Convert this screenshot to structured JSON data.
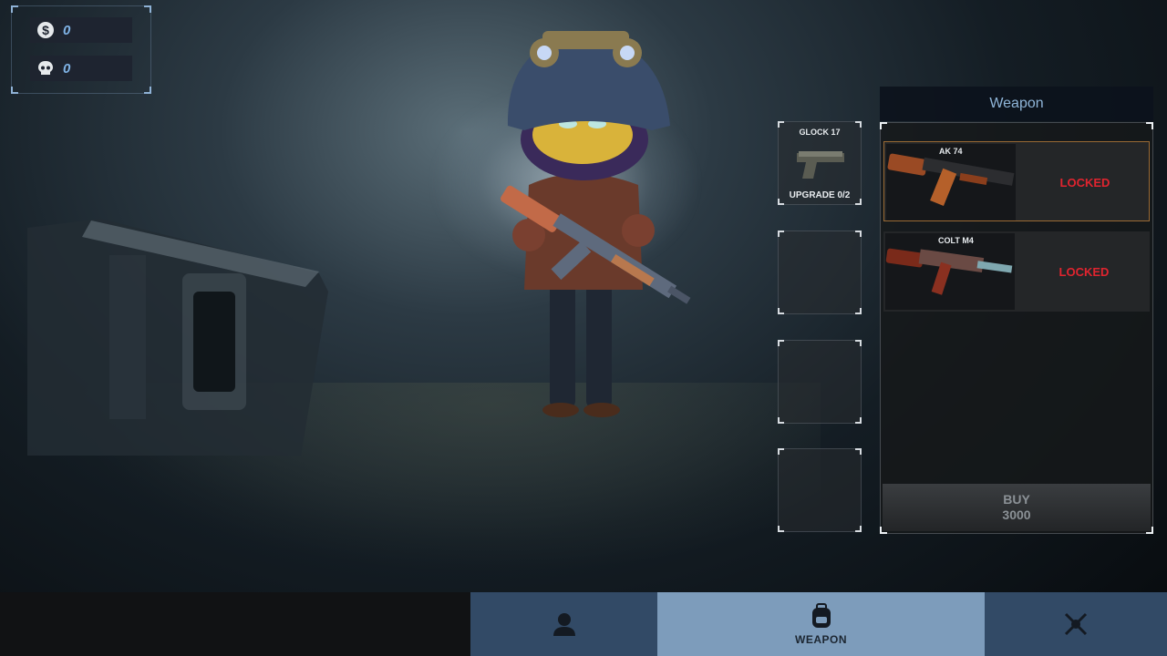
{
  "hud": {
    "money": {
      "icon": "dollar-coin-icon",
      "value": "0"
    },
    "kills": {
      "icon": "skull-icon",
      "value": "0"
    }
  },
  "slots": [
    {
      "name": "GLOCK 17",
      "upgrade": "UPGRADE 0/2",
      "icon": "pistol-icon"
    },
    {
      "name": "",
      "upgrade": ""
    },
    {
      "name": "",
      "upgrade": ""
    },
    {
      "name": "",
      "upgrade": ""
    }
  ],
  "weapon_panel": {
    "title": "Weapon",
    "items": [
      {
        "name": "AK 74",
        "status": "LOCKED",
        "selected": true,
        "icon": "ak74-rifle-icon"
      },
      {
        "name": "COLT M4",
        "status": "LOCKED",
        "selected": false,
        "icon": "m4-rifle-icon"
      }
    ],
    "buy_label": "BUY",
    "buy_price": "3000"
  },
  "bottom_tabs": [
    {
      "icon": "character-icon",
      "label": ""
    },
    {
      "icon": "backpack-icon",
      "label": "WEAPON",
      "active": true
    },
    {
      "icon": "crossed-swords-icon",
      "label": ""
    }
  ],
  "colors": {
    "accent_blue": "#7d9cbb",
    "locked_red": "#e0242f",
    "tab_dark": "#324a66"
  }
}
